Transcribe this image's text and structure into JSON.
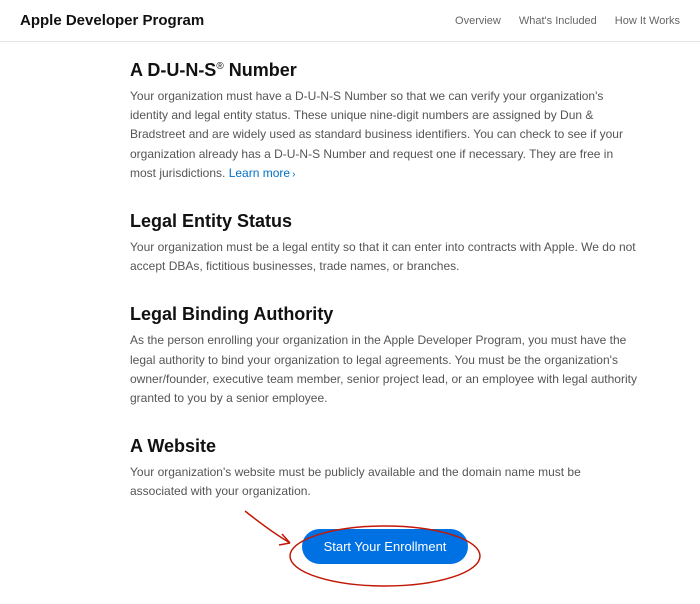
{
  "header": {
    "brand": "Apple Developer Program",
    "nav": [
      "Overview",
      "What's Included",
      "How It Works"
    ]
  },
  "sections": [
    {
      "heading_pre": "A D-U-N-S",
      "heading_reg": "®",
      "heading_post": " Number",
      "body": "Your organization must have a D-U-N-S Number so that we can verify your organization's identity and legal entity status. These unique nine-digit numbers are assigned by Dun & Bradstreet and are widely used as standard business identifiers. You can check to see if your organization already has a D-U-N-S Number and request one if necessary. They are free in most jurisdictions. ",
      "link": "Learn more"
    },
    {
      "heading": "Legal Entity Status",
      "body": "Your organization must be a legal entity so that it can enter into contracts with Apple. We do not accept DBAs, fictitious businesses, trade names, or branches."
    },
    {
      "heading": "Legal Binding Authority",
      "body": "As the person enrolling your organization in the Apple Developer Program, you must have the legal authority to bind your organization to legal agreements. You must be the organization's owner/founder, executive team member, senior project lead, or an employee with legal authority granted to you by a senior employee."
    },
    {
      "heading": "A Website",
      "body": "Your organization's website must be publicly available and the domain name must be associated with your organization."
    }
  ],
  "cta": {
    "label": "Start Your Enrollment"
  }
}
